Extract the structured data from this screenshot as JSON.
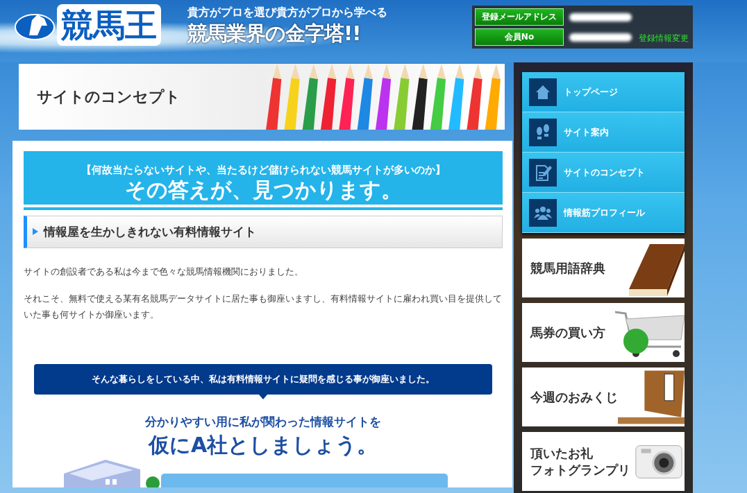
{
  "header": {
    "logo": "競馬王",
    "tagline_top": "貴方がプロを選び貴方がプロから学べる",
    "tagline_main": "競馬業界の金字塔!!",
    "member_fields": [
      {
        "label": "登録メールアドレス"
      },
      {
        "label": "会員No"
      }
    ],
    "change_link": "登録情報変更"
  },
  "page_banner": {
    "title": "サイトのコンセプト"
  },
  "content": {
    "lead_question": "【何故当たらないサイトや、当たるけど儲けられない競馬サイトが多いのか】",
    "lead_answer": "その答えが、見つかります。",
    "section_heading": "情報屋を生かしきれない有料情報サイト",
    "paragraphs": [
      "サイトの創設者である私は今まで色々な競馬情報機関におりました。",
      "それこそ、無料で使える某有名競馬データサイトに居た事も御座いますし、有料情報サイトに雇われ買い目を提供していた事も何サイトか御座います。"
    ],
    "callout": "そんな暮らしをしている中、私は有料情報サイトに疑問を感じる事が御座いました。",
    "subtitle": "分かりやすい用に私が関わった情報サイトを",
    "subtitle_big": "仮にA社としましょう。"
  },
  "sidebar": {
    "nav_items": [
      {
        "label": "トップページ"
      },
      {
        "label": "サイト案内"
      },
      {
        "label": "サイトのコンセプト"
      },
      {
        "label": "情報筋プロフィール"
      }
    ],
    "banners": [
      {
        "label": "競馬用語辞典"
      },
      {
        "label": "馬券の買い方"
      },
      {
        "label": "今週のおみくじ"
      },
      {
        "label": "頂いたお礼",
        "label_line2": "フォトグランプリ"
      }
    ]
  }
}
